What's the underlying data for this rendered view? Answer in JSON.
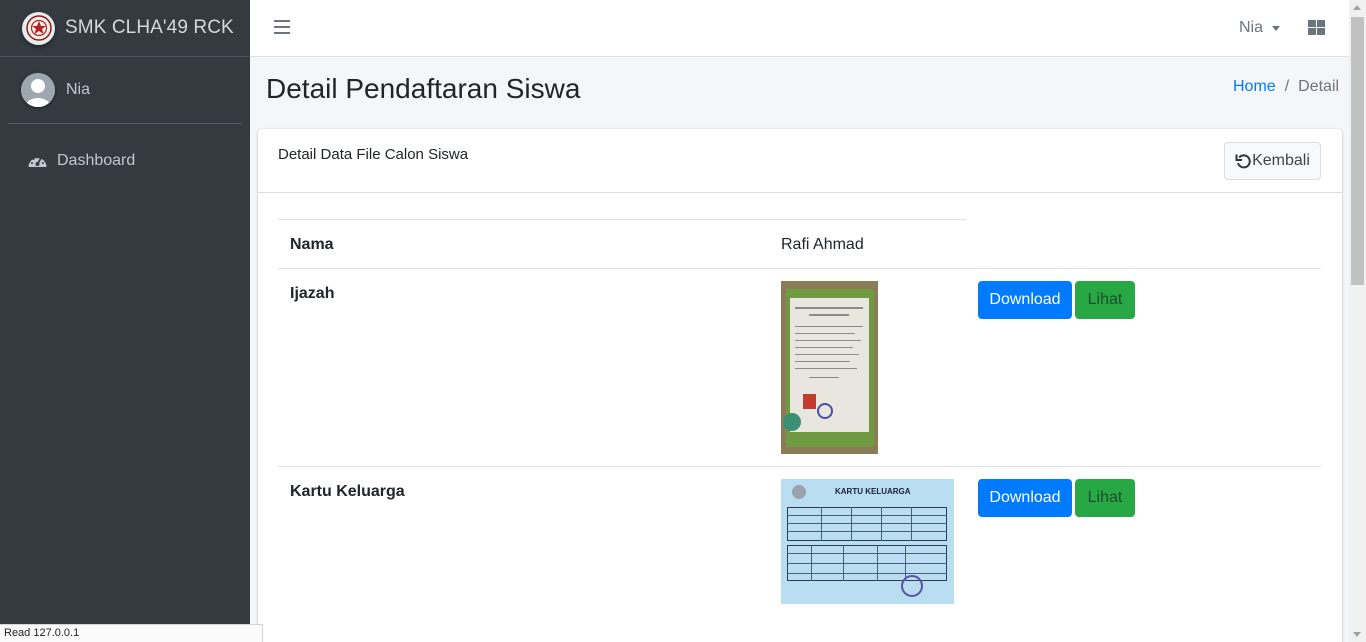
{
  "brand": {
    "name": "SMK CLHA'49 RCK",
    "logo_icon": "school-emblem-icon"
  },
  "user_panel": {
    "name": "Nia"
  },
  "sidebar": {
    "items": [
      {
        "label": "Dashboard",
        "icon": "tachometer-icon"
      }
    ]
  },
  "navbar": {
    "user_label": "Nia",
    "menu_icon": "hamburger-icon",
    "apps_icon": "grid-icon"
  },
  "header": {
    "title": "Detail Pendaftaran Siswa"
  },
  "breadcrumb": {
    "home": "Home",
    "separator": "/",
    "current": "Detail"
  },
  "card": {
    "title": "Detail Data File Calon Siswa",
    "back_label": "Kembali"
  },
  "table": {
    "rows": [
      {
        "label": "Nama",
        "value": "Rafi Ahmad"
      },
      {
        "label": "Ijazah",
        "download": "Download",
        "view": "Lihat",
        "thumbnail": "ijazah-document"
      },
      {
        "label": "Kartu Keluarga",
        "download": "Download",
        "view": "Lihat",
        "thumbnail": "kartu-keluarga-document",
        "thumbnail_title": "KARTU KELUARGA"
      }
    ]
  },
  "statusbar": {
    "text": "Read 127.0.0.1"
  },
  "colors": {
    "sidebar_bg": "#343a40",
    "primary": "#007bff",
    "success": "#28a745"
  }
}
